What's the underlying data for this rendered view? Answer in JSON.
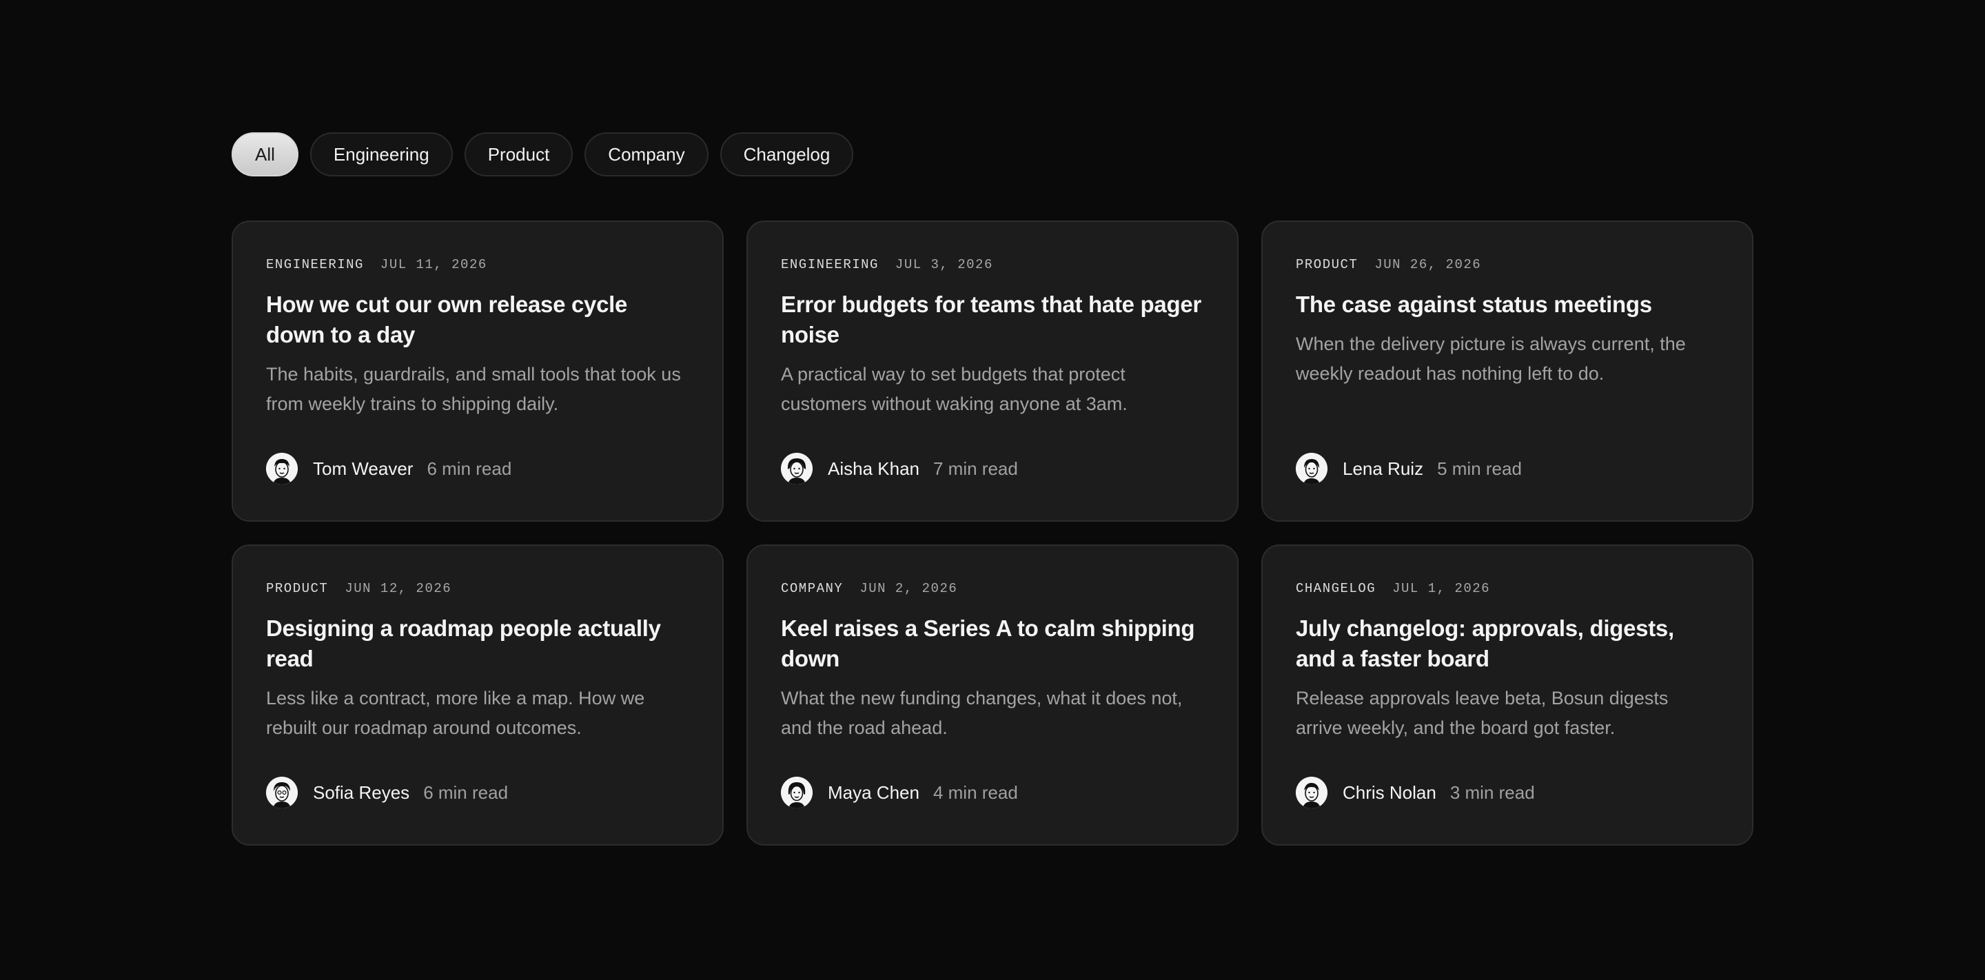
{
  "filters": [
    {
      "label": "All",
      "active": true
    },
    {
      "label": "Engineering",
      "active": false
    },
    {
      "label": "Product",
      "active": false
    },
    {
      "label": "Company",
      "active": false
    },
    {
      "label": "Changelog",
      "active": false
    }
  ],
  "posts": [
    {
      "category": "ENGINEERING",
      "date": "JUL 11, 2026",
      "title": "How we cut our own release cycle down to a day",
      "excerpt": "The habits, guardrails, and small tools that took us from weekly trains to shipping daily.",
      "author": "Tom Weaver",
      "read_time": "6 min read",
      "avatar_icon": "avatar-illustration-icon"
    },
    {
      "category": "ENGINEERING",
      "date": "JUL 3, 2026",
      "title": "Error budgets for teams that hate pager noise",
      "excerpt": "A practical way to set budgets that protect customers without waking anyone at 3am.",
      "author": "Aisha Khan",
      "read_time": "7 min read",
      "avatar_icon": "avatar-illustration-icon"
    },
    {
      "category": "PRODUCT",
      "date": "JUN 26, 2026",
      "title": "The case against status meetings",
      "excerpt": "When the delivery picture is always current, the weekly readout has nothing left to do.",
      "author": "Lena Ruiz",
      "read_time": "5 min read",
      "avatar_icon": "avatar-illustration-icon"
    },
    {
      "category": "PRODUCT",
      "date": "JUN 12, 2026",
      "title": "Designing a roadmap people actually read",
      "excerpt": "Less like a contract, more like a map. How we rebuilt our roadmap around outcomes.",
      "author": "Sofia Reyes",
      "read_time": "6 min read",
      "avatar_icon": "avatar-illustration-icon"
    },
    {
      "category": "COMPANY",
      "date": "JUN 2, 2026",
      "title": "Keel raises a Series A to calm shipping down",
      "excerpt": "What the new funding changes, what it does not, and the road ahead.",
      "author": "Maya Chen",
      "read_time": "4 min read",
      "avatar_icon": "avatar-illustration-icon"
    },
    {
      "category": "CHANGELOG",
      "date": "JUL 1, 2026",
      "title": "July changelog: approvals, digests, and a faster board",
      "excerpt": "Release approvals leave beta, Bosun digests arrive weekly, and the board got faster.",
      "author": "Chris Nolan",
      "read_time": "3 min read",
      "avatar_icon": "avatar-illustration-icon"
    }
  ],
  "colors": {
    "background": "#0a0a0a",
    "card": "#1c1c1c",
    "card_border": "#2c2c2c",
    "pill_active": "#d9d9d9",
    "text_primary": "#f4f4f4",
    "text_muted": "#a3a3a3"
  }
}
